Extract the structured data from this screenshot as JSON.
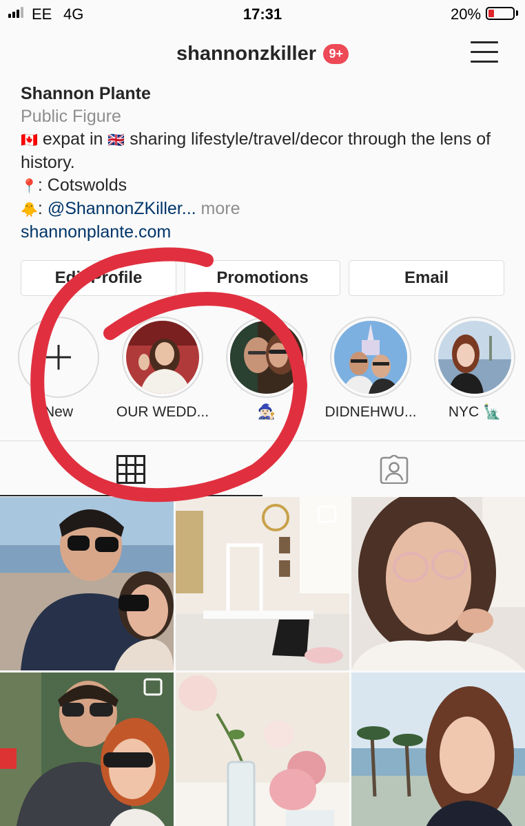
{
  "status_bar": {
    "carrier": "EE",
    "network": "4G",
    "time": "17:31",
    "battery": "20%",
    "battery_level": 0.2
  },
  "header": {
    "username": "shannonzkiller",
    "notification_count": "9+"
  },
  "bio": {
    "name": "Shannon Plante",
    "category": "Public Figure",
    "line1_text_a": " expat in ",
    "line1_text_b": " sharing lifestyle/travel/decor through the lens of history.",
    "location_text": ": Cotswolds",
    "mention_prefix": ": ",
    "mention": "@ShannonZKiller...",
    "more": " more",
    "website": "shannonplante.com"
  },
  "buttons": {
    "edit_profile": "Edit Profile",
    "promotions": "Promotions",
    "email": "Email"
  },
  "highlights": [
    {
      "label": "New"
    },
    {
      "label": "OUR WEDD..."
    },
    {
      "label": "🧙🏻‍♀️"
    },
    {
      "label": "DIDNEHWU..."
    },
    {
      "label": "NYC 🗽"
    }
  ],
  "colors": {
    "link": "#003569",
    "badge": "#ed4956",
    "annotation": "#e0303f"
  }
}
